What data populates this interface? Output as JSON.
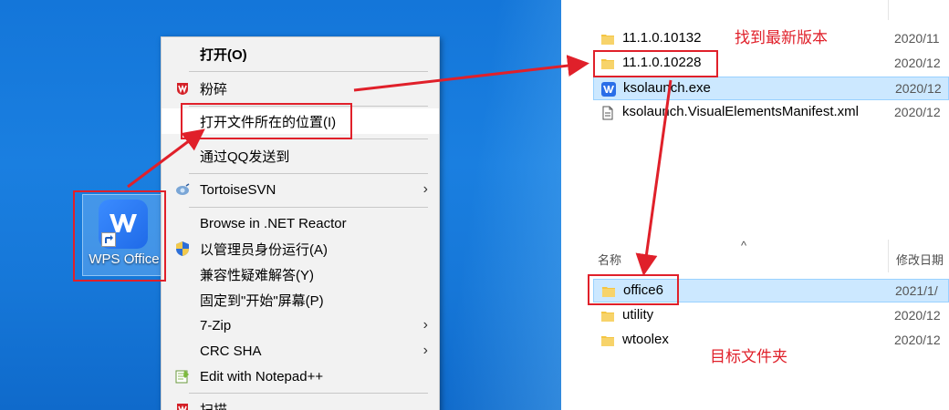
{
  "desktop": {
    "icon_label": "WPS Office"
  },
  "context_menu": {
    "items": [
      {
        "label": "打开(O)",
        "bold": true
      },
      {
        "label": "粉碎",
        "icon": "shred-icon"
      },
      {
        "label": "打开文件所在的位置(I)"
      },
      {
        "label": "通过QQ发送到"
      },
      {
        "label": "TortoiseSVN",
        "icon": "tortoisesvn-icon",
        "submenu": true
      },
      {
        "label": "Browse in .NET Reactor"
      },
      {
        "label": "以管理员身份运行(A)",
        "icon": "uac-shield-icon"
      },
      {
        "label": "兼容性疑难解答(Y)"
      },
      {
        "label": "固定到\"开始\"屏幕(P)"
      },
      {
        "label": "7-Zip",
        "submenu": true
      },
      {
        "label": "CRC SHA",
        "submenu": true
      },
      {
        "label": "Edit with Notepad++",
        "icon": "notepadpp-icon"
      },
      {
        "label": "扫描",
        "icon": "scan-icon"
      }
    ],
    "submenu_arrow": "›"
  },
  "explorer_top": {
    "rows": [
      {
        "name": "11.1.0.10132",
        "date": "2020/11",
        "type": "folder"
      },
      {
        "name": "11.1.0.10228",
        "date": "2020/12",
        "type": "folder"
      },
      {
        "name": "ksolaunch.exe",
        "date": "2020/12",
        "type": "exe",
        "selected": true
      },
      {
        "name": "ksolaunch.VisualElementsManifest.xml",
        "date": "2020/12",
        "type": "file"
      }
    ]
  },
  "explorer_bottom": {
    "header_name": "名称",
    "header_date": "修改日期",
    "sort_glyph": "^",
    "rows": [
      {
        "name": "office6",
        "date": "2021/1/",
        "type": "folder",
        "selected": true
      },
      {
        "name": "utility",
        "date": "2020/12",
        "type": "folder"
      },
      {
        "name": "wtoolex",
        "date": "2020/12",
        "type": "folder"
      }
    ]
  },
  "annotations": {
    "find_latest": "找到最新版本",
    "target_folder": "目标文件夹"
  },
  "colors": {
    "annotation_red": "#e0202a",
    "desktop_blue": "#1677d8",
    "selection_blue": "#cce8ff",
    "folder_yellow": "#f4c542"
  }
}
